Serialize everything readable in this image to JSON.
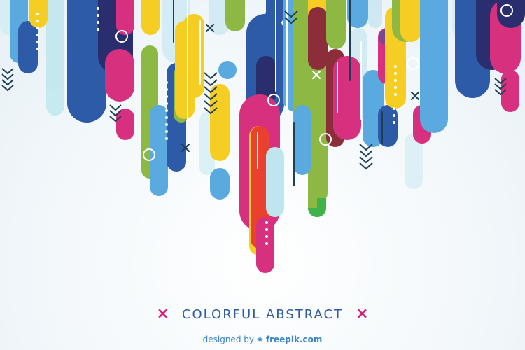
{
  "title": "COLORFUL ABSTRACT",
  "title_marker": "×",
  "credit": {
    "prefix": "designed by",
    "brand": "freepik.com",
    "brand_icon": "freepik-logo-icon"
  },
  "colors": {
    "blue": "#2d5ba8",
    "navy": "#2a2d6e",
    "sky": "#5aa9df",
    "pale": "#bfe6ee",
    "pink": "#d6307f",
    "yellow": "#f6cd22",
    "green": "#8cb843",
    "maroon": "#8b2e3a",
    "red": "#e8412d",
    "dark": "#1f3f55",
    "accent_text": "#2e5aa6",
    "accent_x": "#d6197a"
  }
}
